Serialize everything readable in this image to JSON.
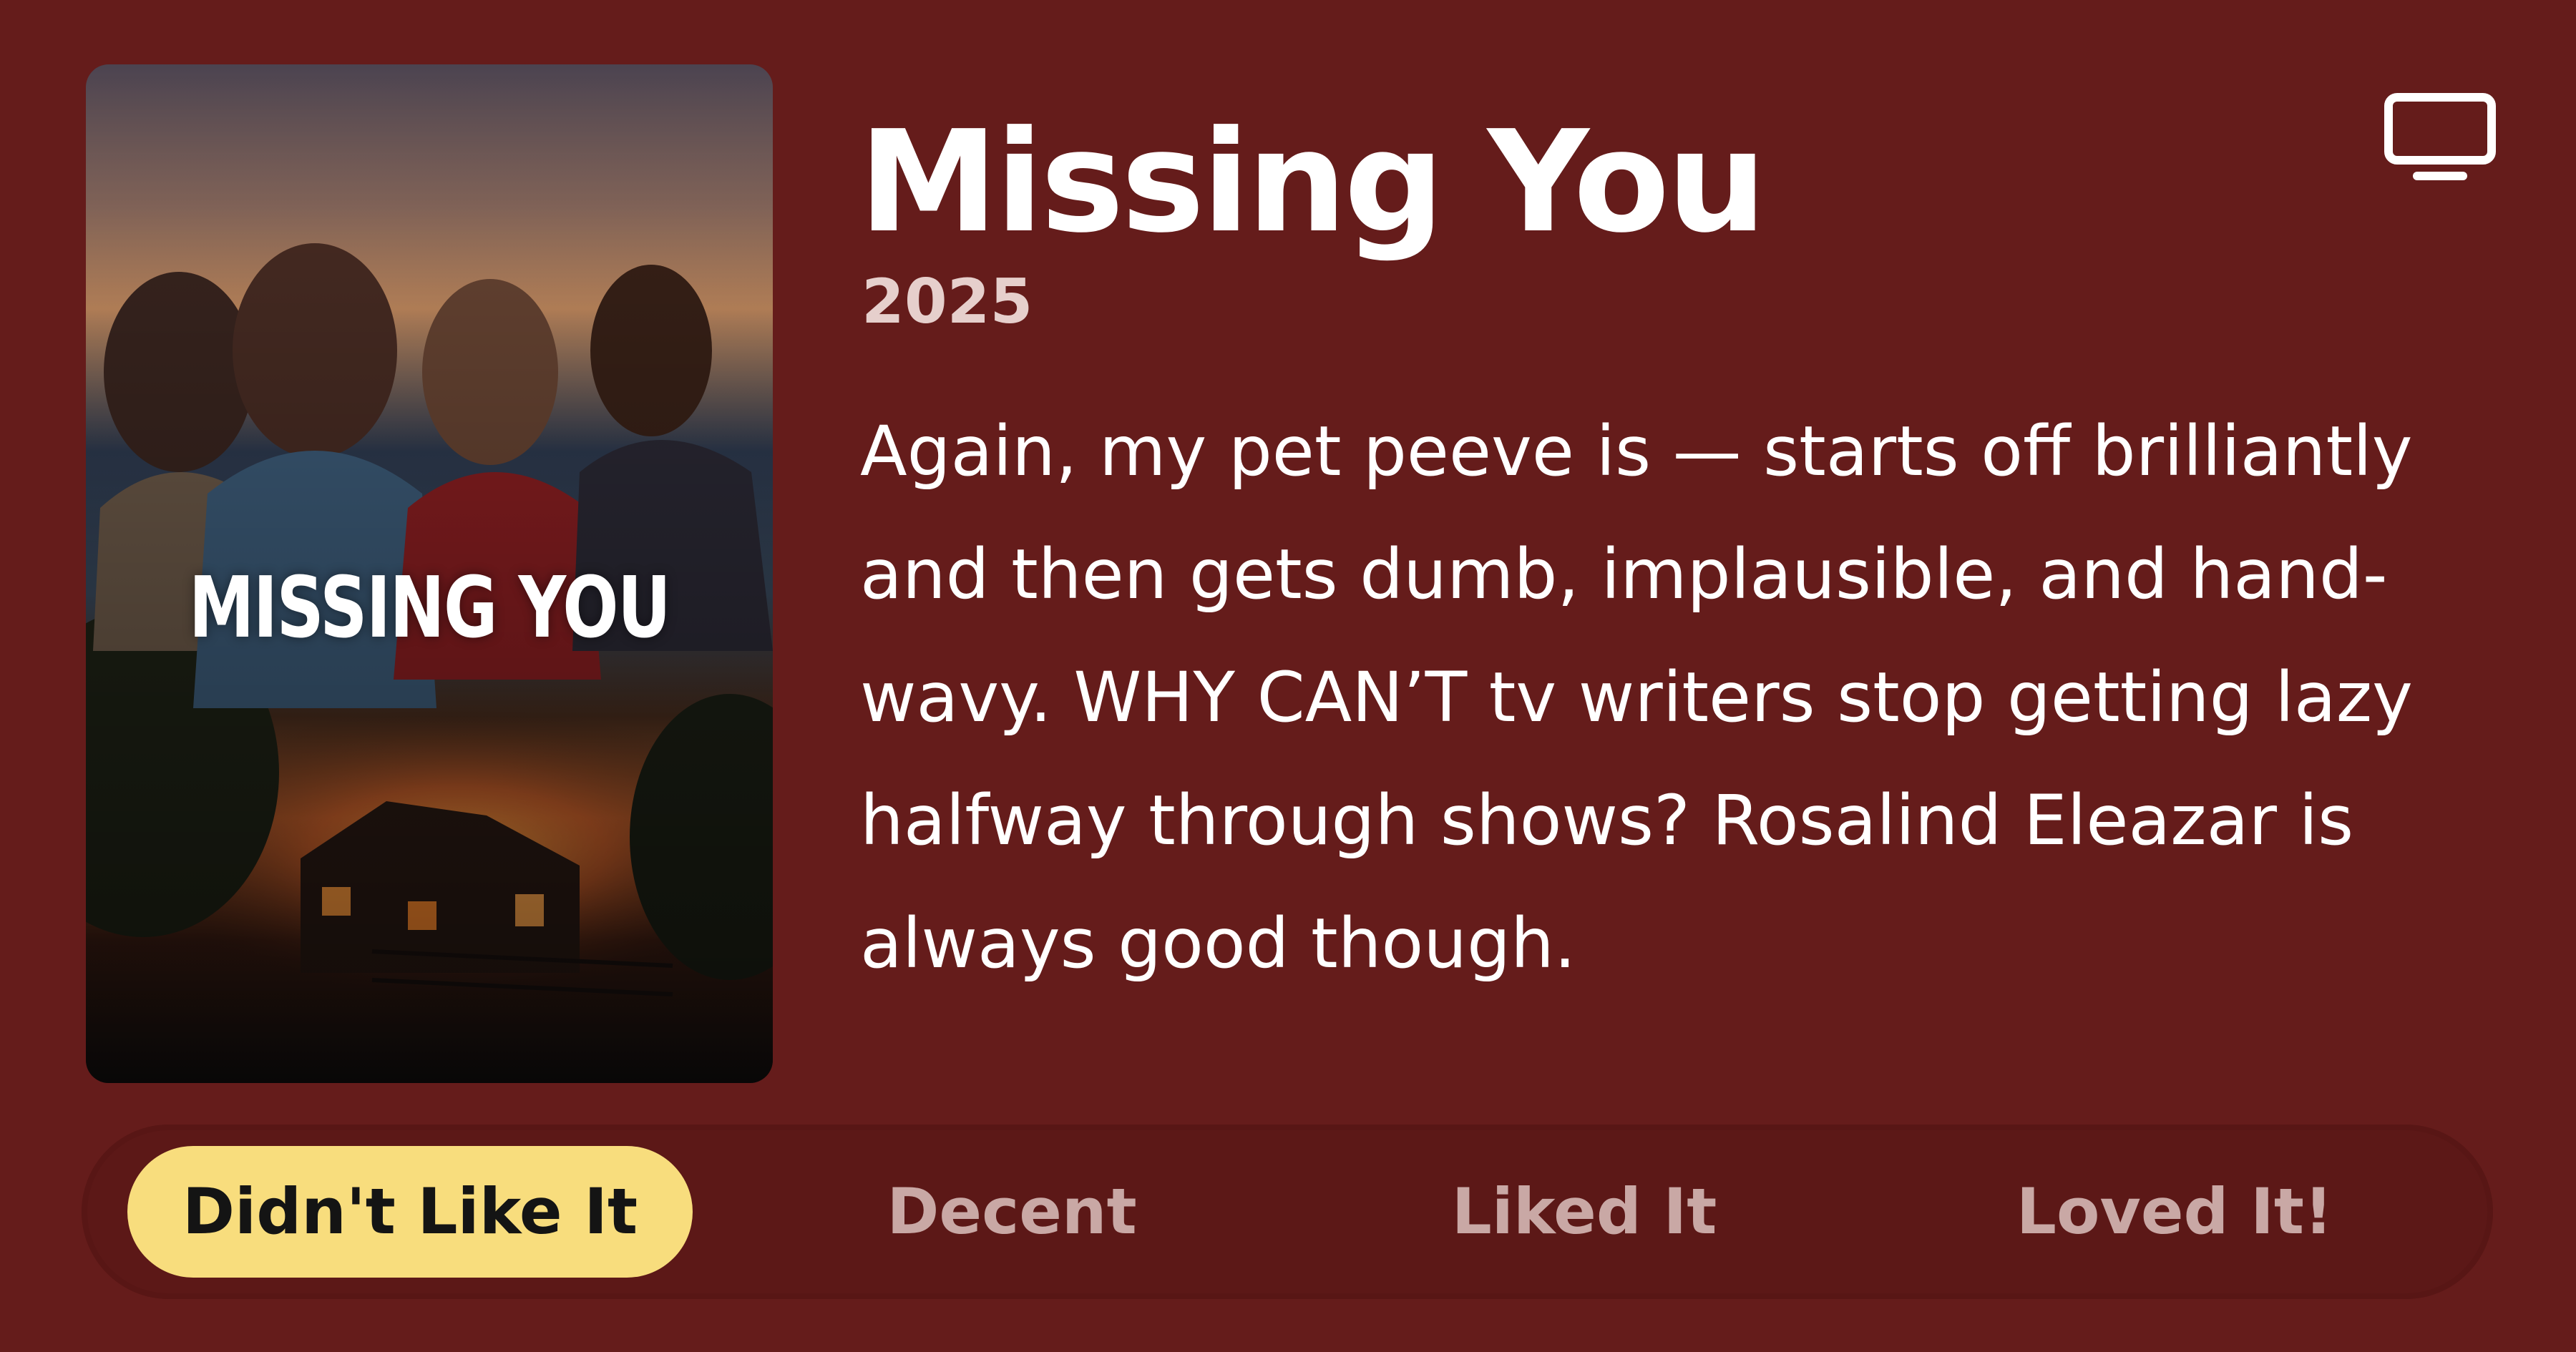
{
  "app": {
    "background_color": "#651c1b",
    "accent_color": "#f8dd7d"
  },
  "poster": {
    "title_text": "MISSING YOU"
  },
  "header": {
    "title": "Missing You",
    "year": "2025",
    "device_icon": "tv-icon"
  },
  "review": {
    "text": "Again, my pet peeve is — starts off brilliantly and then gets dumb, implausible, and hand-wavy. WHY CAN’T tv writers stop getting lazy halfway through shows? Rosalind Eleazar is always good though."
  },
  "rating": {
    "selected": "Didn't Like It",
    "options": [
      {
        "label": "Didn't Like It"
      },
      {
        "label": "Decent"
      },
      {
        "label": "Liked It"
      },
      {
        "label": "Loved It!"
      }
    ]
  }
}
